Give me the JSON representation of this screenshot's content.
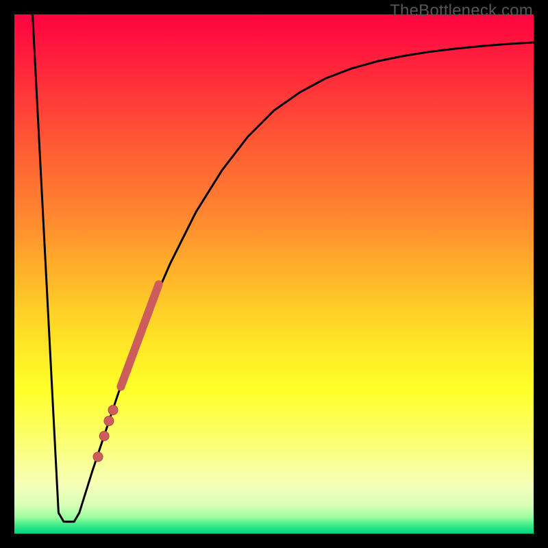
{
  "watermark": "TheBottleneck.com",
  "colors": {
    "frame": "#000000",
    "curve": "#000000",
    "dots_fill": "#cd5d5d",
    "dots_stroke": "#b04a4a",
    "segment": "#cd5d5d",
    "gradient_stops": [
      {
        "offset": 0.0,
        "color": "#ff0240"
      },
      {
        "offset": 0.12,
        "color": "#ff2b3b"
      },
      {
        "offset": 0.25,
        "color": "#ff5a34"
      },
      {
        "offset": 0.38,
        "color": "#ff8430"
      },
      {
        "offset": 0.5,
        "color": "#ffb42a"
      },
      {
        "offset": 0.62,
        "color": "#ffe126"
      },
      {
        "offset": 0.72,
        "color": "#ffff28"
      },
      {
        "offset": 0.82,
        "color": "#fbff70"
      },
      {
        "offset": 0.905,
        "color": "#f6ffb8"
      },
      {
        "offset": 0.945,
        "color": "#d8ffb8"
      },
      {
        "offset": 0.968,
        "color": "#9effa0"
      },
      {
        "offset": 0.985,
        "color": "#35e985"
      },
      {
        "offset": 1.0,
        "color": "#00d481"
      }
    ]
  },
  "chart_data": {
    "type": "line",
    "title": "",
    "xlabel": "",
    "ylabel": "",
    "xlim": [
      0,
      100
    ],
    "ylim": [
      0,
      100
    ],
    "curve": [
      {
        "x": 3.5,
        "y": 100.0
      },
      {
        "x": 8.5,
        "y": 4.0
      },
      {
        "x": 9.5,
        "y": 2.3
      },
      {
        "x": 11.5,
        "y": 2.3
      },
      {
        "x": 12.5,
        "y": 4.0
      },
      {
        "x": 15.0,
        "y": 12.0
      },
      {
        "x": 20.0,
        "y": 27.0
      },
      {
        "x": 25.0,
        "y": 40.5
      },
      {
        "x": 30.0,
        "y": 52.0
      },
      {
        "x": 35.0,
        "y": 62.0
      },
      {
        "x": 40.0,
        "y": 70.0
      },
      {
        "x": 45.0,
        "y": 76.5
      },
      {
        "x": 50.0,
        "y": 81.5
      },
      {
        "x": 55.0,
        "y": 85.0
      },
      {
        "x": 60.0,
        "y": 87.7
      },
      {
        "x": 65.0,
        "y": 89.6
      },
      {
        "x": 70.0,
        "y": 91.0
      },
      {
        "x": 75.0,
        "y": 92.0
      },
      {
        "x": 80.0,
        "y": 92.8
      },
      {
        "x": 85.0,
        "y": 93.4
      },
      {
        "x": 90.0,
        "y": 93.9
      },
      {
        "x": 95.0,
        "y": 94.3
      },
      {
        "x": 100.0,
        "y": 94.6
      }
    ],
    "series": [
      {
        "name": "highlighted-segment",
        "values": [
          {
            "x": 20.5,
            "y": 28.3
          },
          {
            "x": 27.8,
            "y": 48.0
          }
        ]
      },
      {
        "name": "dots",
        "values": [
          {
            "x": 18.2,
            "y": 21.7
          },
          {
            "x": 19.0,
            "y": 23.8
          },
          {
            "x": 17.3,
            "y": 18.8
          },
          {
            "x": 16.1,
            "y": 14.8
          }
        ]
      }
    ]
  }
}
